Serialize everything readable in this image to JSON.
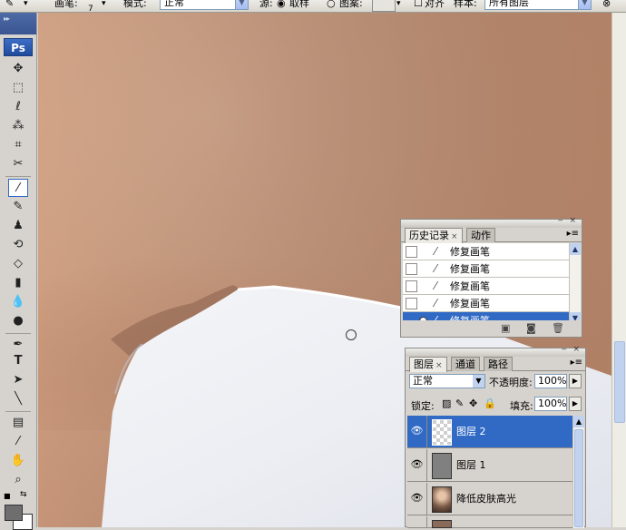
{
  "options_bar": {
    "brush_label": "画笔:",
    "brush_size": "7",
    "mode_label": "模式:",
    "mode_value": "正常",
    "source_label": "源:",
    "sampled_label": "取样",
    "pattern_label": "图案:",
    "aligned_label": "对齐",
    "sample_label": "样本:",
    "sample_value": "所有图层"
  },
  "toolbox": {
    "logo": "Ps",
    "tools": [
      "move-icon",
      "marquee-icon",
      "lasso-icon",
      "magic-wand-icon",
      "crop-icon",
      "slice-icon",
      "healing-brush-icon",
      "brush-icon",
      "clone-stamp-icon",
      "history-brush-icon",
      "eraser-icon",
      "gradient-icon",
      "blur-icon",
      "dodge-icon",
      "pen-icon",
      "type-icon",
      "path-selection-icon",
      "line-icon",
      "notes-icon",
      "eyedropper-icon",
      "hand-icon",
      "zoom-icon"
    ],
    "selected_tool": "healing-brush-icon",
    "foreground_color": "#6e6e6e",
    "background_color": "#ffffff"
  },
  "history_panel": {
    "tabs": [
      "历史记录",
      "动作"
    ],
    "active_tab": "历史记录",
    "items": [
      "修复画笔",
      "修复画笔",
      "修复画笔",
      "修复画笔",
      "修复画笔"
    ],
    "selected_index": 4
  },
  "layers_panel": {
    "tabs": [
      "图层",
      "通道",
      "路径"
    ],
    "active_tab": "图层",
    "blend_mode": "正常",
    "opacity_label": "不透明度:",
    "opacity_value": "100%",
    "lock_label": "锁定:",
    "fill_label": "填充:",
    "fill_value": "100%",
    "layers": [
      "图层 2",
      "图层 1",
      "降低皮肤高光"
    ],
    "selected_index": 0
  },
  "colors": {
    "selection": "#316ac5",
    "skin": "#cc9c7f",
    "shirt": "#eef0f4"
  }
}
